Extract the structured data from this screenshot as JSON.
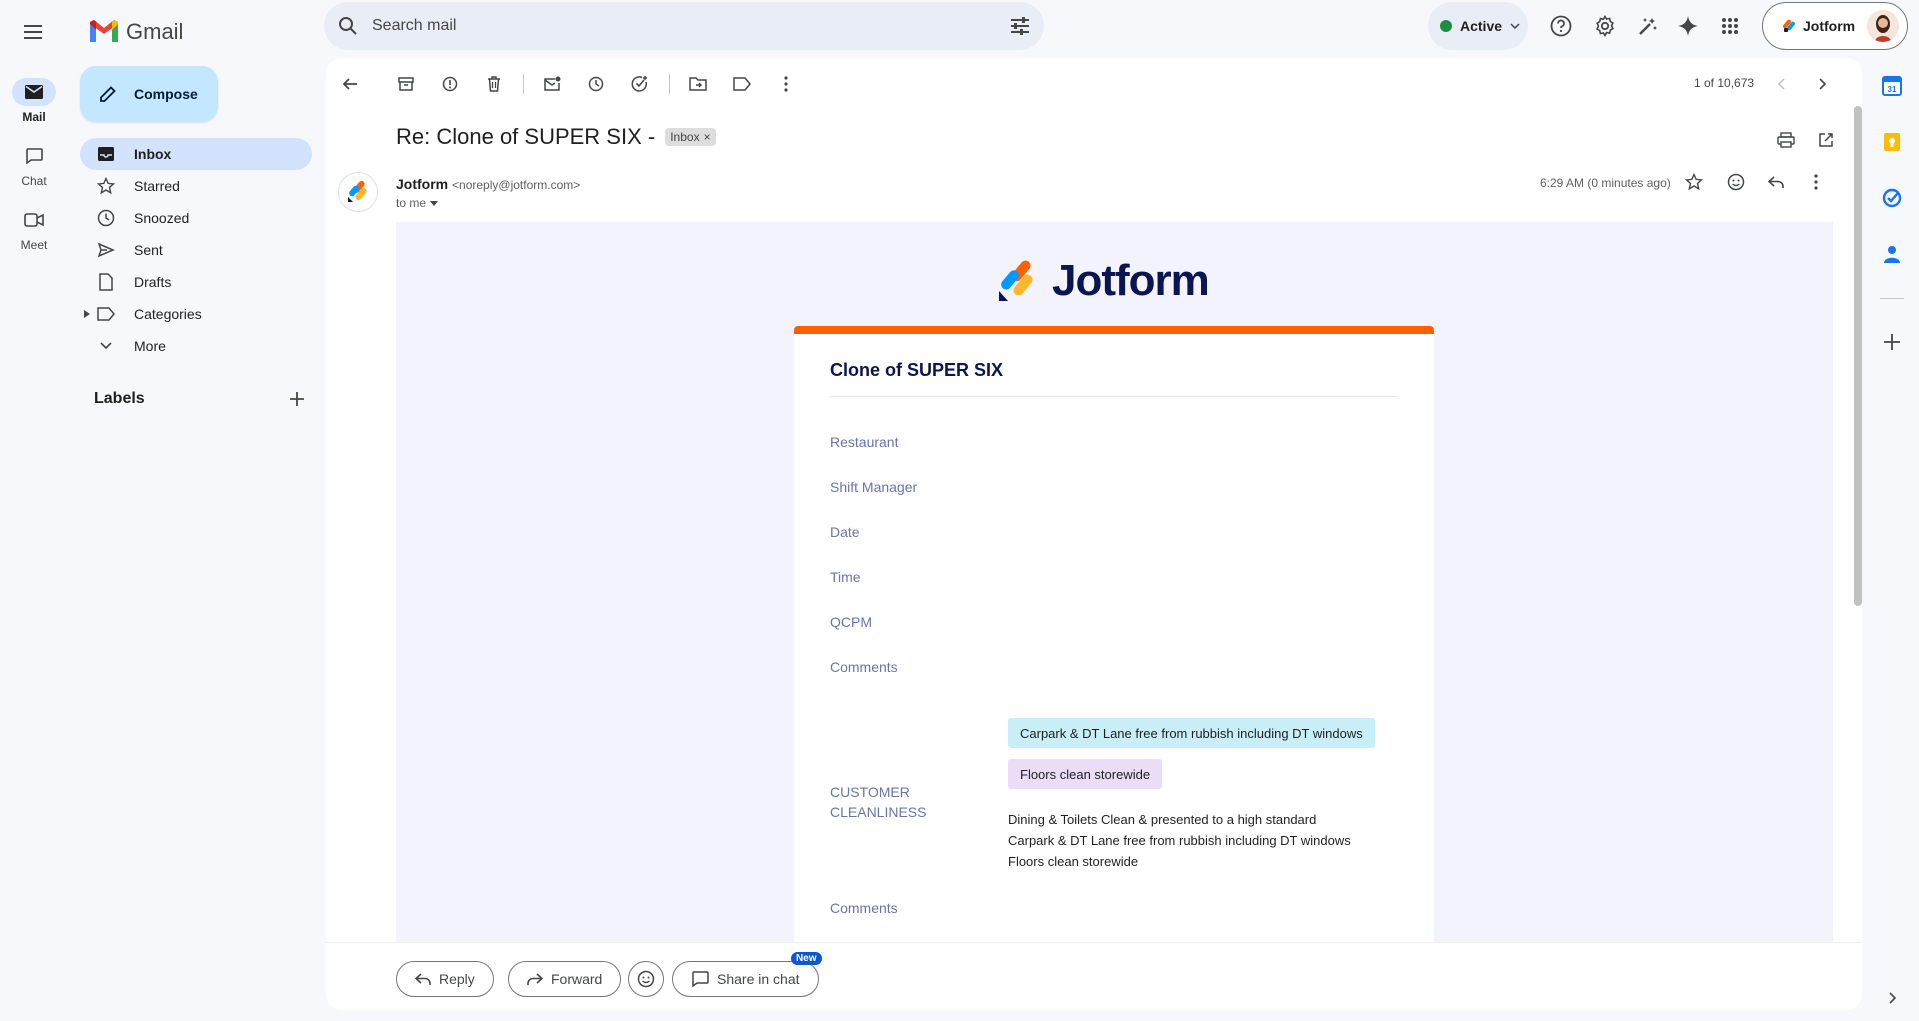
{
  "rail": {
    "items": [
      {
        "label": "Mail"
      },
      {
        "label": "Chat"
      },
      {
        "label": "Meet"
      }
    ]
  },
  "app": {
    "name": "Gmail"
  },
  "search": {
    "placeholder": "Search mail"
  },
  "status": {
    "label": "Active"
  },
  "account": {
    "name": "Jotform"
  },
  "sidebar": {
    "compose_label": "Compose",
    "items": [
      {
        "label": "Inbox",
        "icon": "inbox-icon"
      },
      {
        "label": "Starred",
        "icon": "star-icon"
      },
      {
        "label": "Snoozed",
        "icon": "clock-icon"
      },
      {
        "label": "Sent",
        "icon": "send-icon"
      },
      {
        "label": "Drafts",
        "icon": "draft-icon"
      },
      {
        "label": "Categories",
        "icon": "label-icon"
      },
      {
        "label": "More",
        "icon": "chevron-down-icon"
      }
    ],
    "labels_heading": "Labels"
  },
  "toolbar": {
    "pager": "1 of 10,673"
  },
  "message": {
    "subject": "Re: Clone of SUPER SIX -",
    "inbox_chip": "Inbox",
    "sender_name": "Jotform",
    "sender_email": "<noreply@jotform.com>",
    "to": "to me",
    "timestamp": "6:29 AM (0 minutes ago)"
  },
  "email": {
    "brand": "Jotform",
    "form_title": "Clone of SUPER SIX",
    "fields": [
      "Restaurant",
      "Shift Manager",
      "Date",
      "Time",
      "QCPM",
      "Comments"
    ],
    "section_label_line1": "CUSTOMER",
    "section_label_line2": "CLEANLINESS",
    "chips": [
      "Carpark & DT Lane free from rubbish including DT windows",
      "Floors clean storewide"
    ],
    "values": [
      "Dining & Toilets Clean & presented to a high standard",
      "Carpark & DT Lane free from rubbish including DT windows",
      "Floors clean storewide"
    ],
    "trailing_field": "Comments"
  },
  "reply_bar": {
    "reply": "Reply",
    "forward": "Forward",
    "share": "Share in chat",
    "new_badge": "New"
  },
  "colors": {
    "accent": "#0b57d0",
    "compose_bg": "#c2e7ff",
    "jotform_orange": "#ff6100",
    "jotform_navy": "#0a1551"
  }
}
